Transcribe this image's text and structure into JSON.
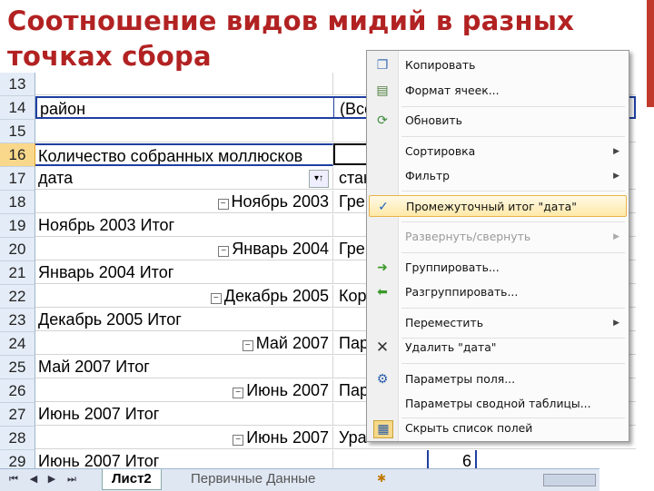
{
  "title": "Соотношение видов мидий в разных точках сбора",
  "sheet": {
    "rows": [
      {
        "num": "13",
        "a": "",
        "b": ""
      },
      {
        "num": "14",
        "a": "район",
        "b": "(Все"
      },
      {
        "num": "15",
        "a": "",
        "b": ""
      },
      {
        "num": "16",
        "a": "Количество собранных моллюсков",
        "b": ""
      },
      {
        "num": "17",
        "a": "дата",
        "b": "стан"
      },
      {
        "num": "18",
        "a": "Ноябрь 2003",
        "b": "Гре"
      },
      {
        "num": "19",
        "a": "Ноябрь 2003 Итог",
        "b": ""
      },
      {
        "num": "20",
        "a": "Январь 2004",
        "b": "Гре"
      },
      {
        "num": "21",
        "a": "Январь 2004 Итог",
        "b": ""
      },
      {
        "num": "22",
        "a": "Декабрь 2005",
        "b": "Кор"
      },
      {
        "num": "23",
        "a": "Декабрь 2005 Итог",
        "b": ""
      },
      {
        "num": "24",
        "a": "Май 2007",
        "b": "Пар"
      },
      {
        "num": "25",
        "a": "Май 2007 Итог",
        "b": ""
      },
      {
        "num": "26",
        "a": "Июнь 2007",
        "b": "Пар"
      },
      {
        "num": "27",
        "a": "Июнь 2007 Итог",
        "b": ""
      },
      {
        "num": "28",
        "a": "Июнь 2007",
        "b": "Ура"
      },
      {
        "num": "29",
        "a": "Июнь 2007 Итог",
        "b": "",
        "value": "6"
      }
    ],
    "filter_glyph": "▾↑",
    "expand_glyph": "−"
  },
  "tabs": {
    "nav": [
      "⏮",
      "◀",
      "▶",
      "⏭"
    ],
    "items": [
      "Лист2",
      "Первичные Данные"
    ],
    "active_index": 0
  },
  "menu": {
    "items": [
      {
        "label": "Копировать",
        "icon": "copy-icon",
        "glyph": "❐",
        "underline": "К",
        "disabled": false,
        "submenu": false
      },
      {
        "label": "Формат ячеек...",
        "icon": "format-cells-icon",
        "glyph": "▤",
        "disabled": false,
        "submenu": false
      },
      {
        "label": "Обновить",
        "icon": "refresh-icon",
        "glyph": "⟳",
        "disabled": false,
        "submenu": false
      },
      {
        "label": "Сортировка",
        "icon": "none",
        "glyph": "",
        "disabled": false,
        "submenu": true
      },
      {
        "label": "Фильтр",
        "icon": "none",
        "glyph": "",
        "disabled": false,
        "submenu": true
      },
      {
        "label": "Промежуточный итог \"дата\"",
        "icon": "checkmark-icon",
        "glyph": "✓",
        "disabled": false,
        "submenu": false,
        "highlight": true
      },
      {
        "label": "Развернуть/свернуть",
        "icon": "none",
        "glyph": "",
        "disabled": true,
        "submenu": true
      },
      {
        "label": "Группировать...",
        "icon": "group-arrow-icon",
        "glyph": "➜",
        "disabled": false,
        "submenu": false
      },
      {
        "label": "Разгруппировать...",
        "icon": "ungroup-arrow-icon",
        "glyph": "⬅",
        "disabled": false,
        "submenu": false
      },
      {
        "label": "Переместить",
        "icon": "none",
        "glyph": "",
        "disabled": false,
        "submenu": true
      },
      {
        "label": "Удалить \"дата\"",
        "icon": "delete-x-icon",
        "glyph": "✕",
        "disabled": false,
        "submenu": false
      },
      {
        "label": "Параметры поля...",
        "icon": "field-settings-icon",
        "glyph": "⚙",
        "disabled": false,
        "submenu": false
      },
      {
        "label": "Параметры сводной таблицы...",
        "icon": "none",
        "glyph": "",
        "disabled": false,
        "submenu": false
      },
      {
        "label": "Скрыть список полей",
        "icon": "field-list-icon",
        "glyph": "▦",
        "disabled": false,
        "submenu": false
      }
    ],
    "submenu_glyph": "▶"
  },
  "colors": {
    "title": "#b22222",
    "accent_bar": "#c0392b",
    "table_border": "#1f3fa0",
    "menu_highlight": "#ffe9a8",
    "active_row_header": "#f9d88b"
  }
}
